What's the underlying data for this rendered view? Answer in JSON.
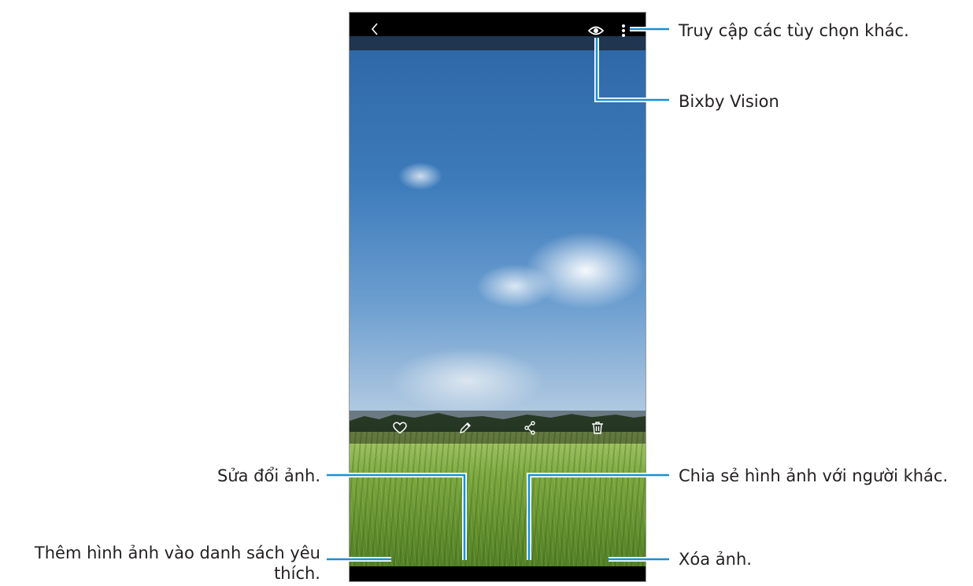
{
  "annotations": {
    "more_options": "Truy cập các tùy chọn khác.",
    "bixby_vision": "Bixby Vision",
    "edit_photo": "Sửa đổi ảnh.",
    "share": "Chia sẻ hình ảnh với người khác.",
    "favorite_line1": "Thêm hình ảnh vào danh sách yêu",
    "favorite_line2": "thích.",
    "delete": "Xóa ảnh."
  },
  "icons": {
    "back": "chevron-left",
    "bixby": "eye",
    "more": "kebab-vertical",
    "favorite": "heart-outline",
    "edit": "pencil",
    "share": "share-nodes",
    "delete": "trash"
  },
  "colors": {
    "callout_line": "#1a8fd6",
    "text": "#231f20"
  }
}
